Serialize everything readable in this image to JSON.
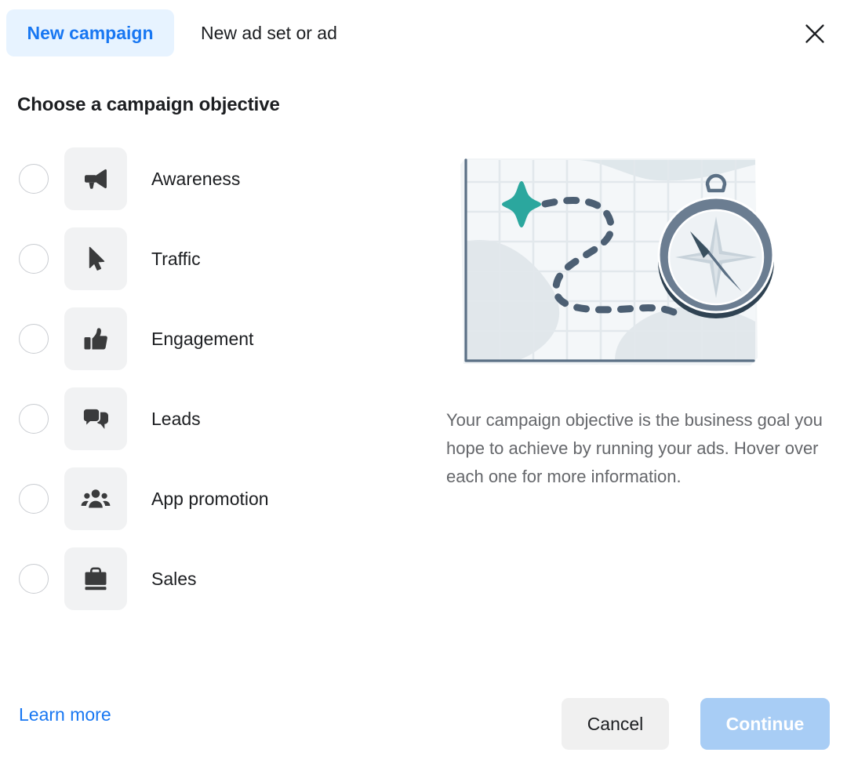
{
  "header": {
    "tabs": [
      {
        "label": "New campaign",
        "active": true,
        "name": "tab-new-campaign"
      },
      {
        "label": "New ad set or ad",
        "active": false,
        "name": "tab-new-ad-set-or-ad"
      }
    ],
    "close_icon": "close-icon"
  },
  "main": {
    "section_title": "Choose a campaign objective",
    "objectives": [
      {
        "label": "Awareness",
        "icon": "megaphone-icon",
        "selected": false
      },
      {
        "label": "Traffic",
        "icon": "cursor-arrow-icon",
        "selected": false
      },
      {
        "label": "Engagement",
        "icon": "thumbs-up-icon",
        "selected": false
      },
      {
        "label": "Leads",
        "icon": "speech-bubbles-icon",
        "selected": false
      },
      {
        "label": "App promotion",
        "icon": "people-group-icon",
        "selected": false
      },
      {
        "label": "Sales",
        "icon": "briefcase-icon",
        "selected": false
      }
    ]
  },
  "right_panel": {
    "illustration": "map-with-compass-illustration",
    "description": "Your campaign objective is the business goal you hope to achieve by running your ads. Hover over each one for more information."
  },
  "footer": {
    "learn_more_label": "Learn more",
    "cancel_label": "Cancel",
    "continue_label": "Continue"
  },
  "colors": {
    "accent_blue": "#1877f2",
    "tab_active_bg": "#e7f3ff",
    "continue_disabled_bg": "#a8cdf5",
    "cancel_bg": "#f0f0f0",
    "icon_tile_bg": "#f1f2f3",
    "icon_fill": "#3a3b3c",
    "text_primary": "#1c1e21",
    "text_secondary": "#65676b",
    "illustration_teal": "#2ba79e",
    "illustration_slate": "#4c5f73"
  }
}
